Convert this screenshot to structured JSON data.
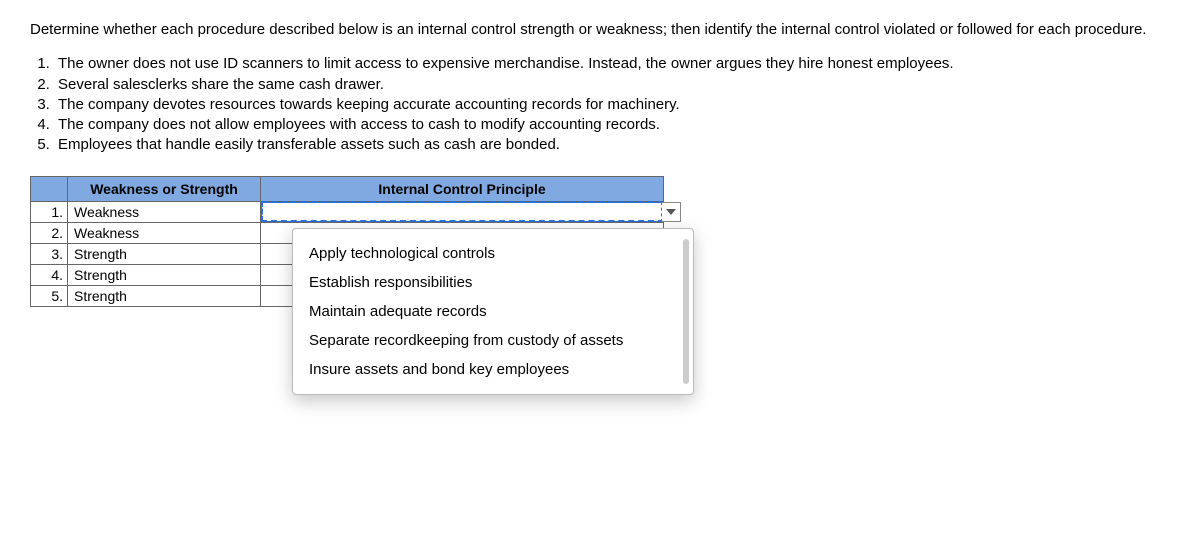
{
  "intro": "Determine whether each procedure described below is an internal control strength or weakness; then identify the internal control violated or followed for each procedure.",
  "questions": [
    "The owner does not use ID scanners to limit access to expensive merchandise. Instead, the owner argues they hire honest employees.",
    "Several salesclerks share the same cash drawer.",
    "The company devotes resources towards keeping accurate accounting records for machinery.",
    "The company does not allow employees with access to cash to modify accounting records.",
    "Employees that handle easily transferable assets such as cash are bonded."
  ],
  "table": {
    "headers": {
      "ws": "Weakness or Strength",
      "icp": "Internal Control Principle"
    },
    "rows": [
      {
        "num": "1.",
        "ws": "Weakness",
        "icp": ""
      },
      {
        "num": "2.",
        "ws": "Weakness",
        "icp": ""
      },
      {
        "num": "3.",
        "ws": "Strength",
        "icp": ""
      },
      {
        "num": "4.",
        "ws": "Strength",
        "icp": ""
      },
      {
        "num": "5.",
        "ws": "Strength",
        "icp": ""
      }
    ]
  },
  "dropdown": {
    "options": [
      "Apply technological controls",
      "Establish responsibilities",
      "Maintain adequate records",
      "Separate recordkeeping from custody of assets",
      "Insure assets and bond key employees"
    ]
  }
}
